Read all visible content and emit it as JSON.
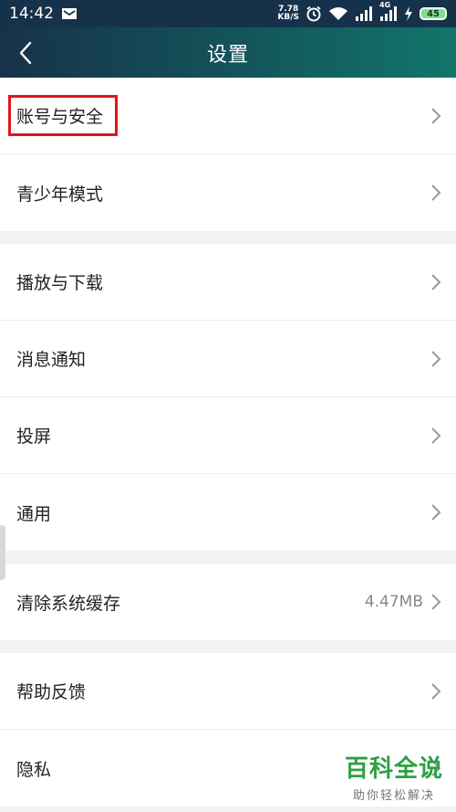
{
  "status_bar": {
    "time": "14:42",
    "net_speed_value": "7.78",
    "net_speed_unit": "KB/S",
    "network_type": "4G",
    "battery_level": "45",
    "icons": [
      "message-icon",
      "alarm-icon",
      "wifi-icon",
      "signal-icon",
      "signal-4g-icon",
      "charging-icon",
      "battery-icon"
    ]
  },
  "header": {
    "title": "设置",
    "back_icon": "back-arrow-icon"
  },
  "groups": [
    {
      "items": [
        {
          "label": "账号与安全",
          "highlighted": true
        },
        {
          "label": "青少年模式"
        }
      ]
    },
    {
      "items": [
        {
          "label": "播放与下载"
        },
        {
          "label": "消息通知"
        },
        {
          "label": "投屏"
        },
        {
          "label": "通用"
        }
      ]
    },
    {
      "items": [
        {
          "label": "清除系统缓存",
          "value": "4.47MB"
        }
      ]
    },
    {
      "items": [
        {
          "label": "帮助反馈"
        },
        {
          "label": "隐私"
        }
      ]
    }
  ],
  "watermark": {
    "title": "百科全说",
    "subtitle": "助你轻松解决"
  },
  "colors": {
    "header_start": "#16324a",
    "header_end": "#12756a",
    "highlight": "#e0141b",
    "watermark": "#2e9f44"
  }
}
